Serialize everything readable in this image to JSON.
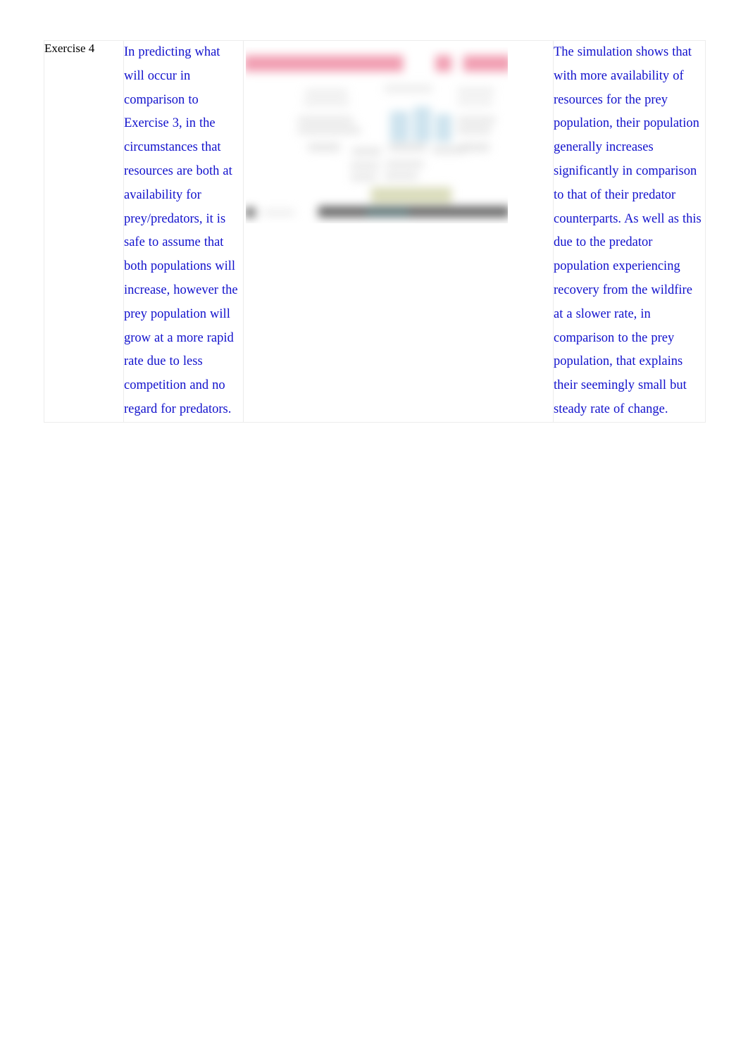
{
  "document": {
    "page_background": "#ffffff",
    "text_color_blue": "#1111cc",
    "text_color_black": "#000000",
    "border_color": "#ececec"
  },
  "table": {
    "row": {
      "label": "Exercise 4",
      "prediction": "In predicting what will occur in comparison to Exercise 3, in the circumstances that resources are both at availability for prey/predators, it is safe to assume that both populations will increase, however the prey population will grow at a more rapid rate due to less competition and no regard for predators.",
      "observation": "The simulation shows that with more availability of resources for the prey population, their population generally increases significantly in comparison to that of their predator counterparts. As well as this due to the predator population experiencing recovery from the wildfire at a slower rate, in comparison to the prey population, that explains their seemingly small but steady rate of change."
    },
    "embedded_image": {
      "alt": "blurred simulation screenshot",
      "banner_color": "#ef8fa6",
      "highlight_color": "#bcd9e8",
      "footer_color": "#4a4a4a",
      "olive_color": "#d6d8b4"
    }
  }
}
